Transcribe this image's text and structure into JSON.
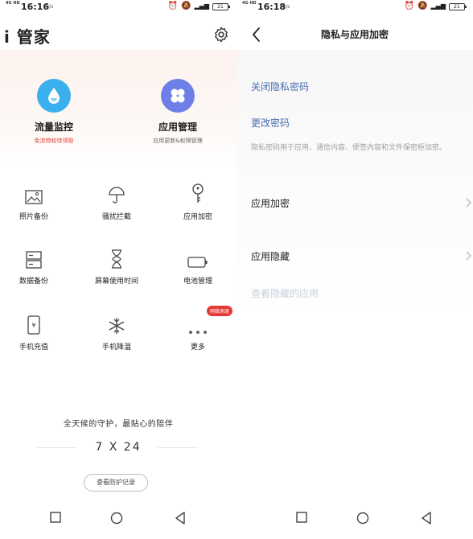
{
  "left": {
    "status": {
      "carrier": "4G HD",
      "time": "16:16",
      "unit": "B/s",
      "battery": "21"
    },
    "title": "i 管家",
    "features": [
      {
        "title": "流量监控",
        "sub": "免流特权待领取"
      },
      {
        "title": "应用管理",
        "sub": "应用更新&权限管理"
      }
    ],
    "grid": [
      {
        "label": "照片备份",
        "icon": "photo-icon"
      },
      {
        "label": "骚扰拦截",
        "icon": "umbrella-icon"
      },
      {
        "label": "应用加密",
        "icon": "key-icon"
      },
      {
        "label": "数据备份",
        "icon": "storage-icon"
      },
      {
        "label": "屏幕使用时间",
        "icon": "hourglass-icon"
      },
      {
        "label": "电池管理",
        "icon": "battery-icon"
      },
      {
        "label": "手机充值",
        "icon": "recharge-icon"
      },
      {
        "label": "手机降温",
        "icon": "snowflake-icon"
      },
      {
        "label": "更多",
        "icon": "more-dots-icon"
      }
    ],
    "badge": "网络测速",
    "slogan": "全天候的守护，最贴心的陪伴",
    "motto": "7 X 24",
    "record_button": "查看防护记录"
  },
  "right": {
    "status": {
      "carrier": "4G HD",
      "time": "16:18",
      "unit": "B/s",
      "battery": "21"
    },
    "title": "隐私与应用加密",
    "close_privacy": "关闭隐私密码",
    "change_password": "更改密码",
    "description": "隐私密码用于应用、通信内容、便签内容和文件保密柜加密。",
    "app_encrypt": "应用加密",
    "app_hide": "应用隐藏",
    "view_hidden": "查看隐藏的应用"
  },
  "colors": {
    "link": "#4a6fb0",
    "flow_blue": "#3bb0ee",
    "app_purple": "#6f7fe8",
    "badge_red": "#e53935"
  }
}
